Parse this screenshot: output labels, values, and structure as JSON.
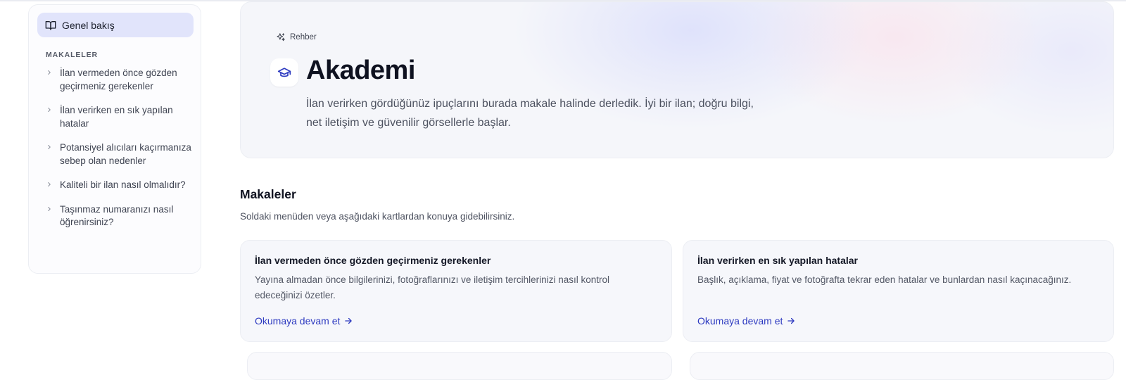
{
  "sidebar": {
    "overview_label": "Genel bakış",
    "section_label": "MAKALELER",
    "items": [
      {
        "label": "İlan vermeden önce gözden geçirmeniz gerekenler"
      },
      {
        "label": "İlan verirken en sık yapılan hatalar"
      },
      {
        "label": "Potansiyel alıcıları kaçırmanıza sebep olan nedenler"
      },
      {
        "label": "Kaliteli bir ilan nasıl olmalıdır?"
      },
      {
        "label": "Taşınmaz numaranızı nasıl öğrenirsiniz?"
      }
    ]
  },
  "hero": {
    "badge": "Rehber",
    "title": "Akademi",
    "description": "İlan verirken gördüğünüz ipuçlarını burada makale halinde derledik. İyi bir ilan; doğru bilgi, net iletişim ve güvenilir görsellerle başlar."
  },
  "articles": {
    "title": "Makaleler",
    "subtitle": "Soldaki menüden veya aşağıdaki kartlardan konuya gidebilirsiniz.",
    "cards": [
      {
        "title": "İlan vermeden önce gözden geçirmeniz gerekenler",
        "description": "Yayına almadan önce bilgilerinizi, fotoğraflarınızı ve iletişim tercihlerinizi nasıl kontrol edeceğinizi özetler.",
        "link": "Okumaya devam et"
      },
      {
        "title": "İlan verirken en sık yapılan hatalar",
        "description": "Başlık, açıklama, fiyat ve fotoğrafta tekrar eden hatalar ve bunlardan nasıl kaçınacağınız.",
        "link": "Okumaya devam et"
      }
    ]
  },
  "icons": {
    "overview": "book-open-icon",
    "nav_item": "chevron-right-icon",
    "badge": "sparkles-icon",
    "hero": "graduation-cap-icon",
    "card_link": "arrow-right-icon"
  },
  "colors": {
    "accent": "#2d3ac0",
    "active_nav_bg": "#e1e4fb"
  }
}
